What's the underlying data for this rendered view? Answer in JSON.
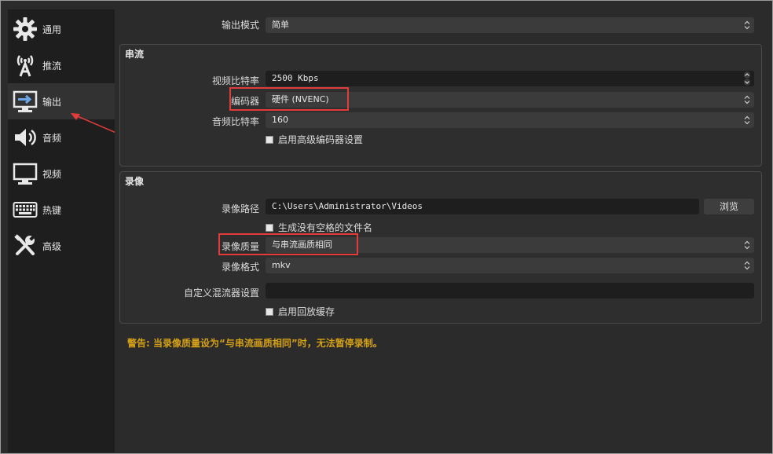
{
  "sidebar": {
    "items": [
      {
        "label": "通用",
        "icon": "gear-icon"
      },
      {
        "label": "推流",
        "icon": "broadcast-icon"
      },
      {
        "label": "输出",
        "icon": "monitor-output-icon",
        "active": true
      },
      {
        "label": "音频",
        "icon": "speaker-icon"
      },
      {
        "label": "视频",
        "icon": "monitor-icon"
      },
      {
        "label": "热键",
        "icon": "keyboard-icon"
      },
      {
        "label": "高级",
        "icon": "tools-icon"
      }
    ]
  },
  "output": {
    "mode_label": "输出模式",
    "mode_value": "简单"
  },
  "streaming": {
    "title": "串流",
    "video_bitrate_label": "视频比特率",
    "video_bitrate_value": "2500 Kbps",
    "encoder_label": "编码器",
    "encoder_value": "硬件 (NVENC)",
    "audio_bitrate_label": "音频比特率",
    "audio_bitrate_value": "160",
    "advanced_encoder_label": "启用高级编码器设置"
  },
  "recording": {
    "title": "录像",
    "path_label": "录像路径",
    "path_value": "C:\\Users\\Administrator\\Videos",
    "browse_label": "浏览",
    "no_space_label": "生成没有空格的文件名",
    "quality_label": "录像质量",
    "quality_value": "与串流画质相同",
    "format_label": "录像格式",
    "format_value": "mkv",
    "muxer_label": "自定义混流器设置",
    "muxer_value": "",
    "replay_buffer_label": "启用回放缓存"
  },
  "warning": "警告: 当录像质量设为“与串流画质相同”时，无法暂停录制。",
  "colors": {
    "annotation_red": "#e23b3b",
    "warning_text": "#d4a017"
  }
}
